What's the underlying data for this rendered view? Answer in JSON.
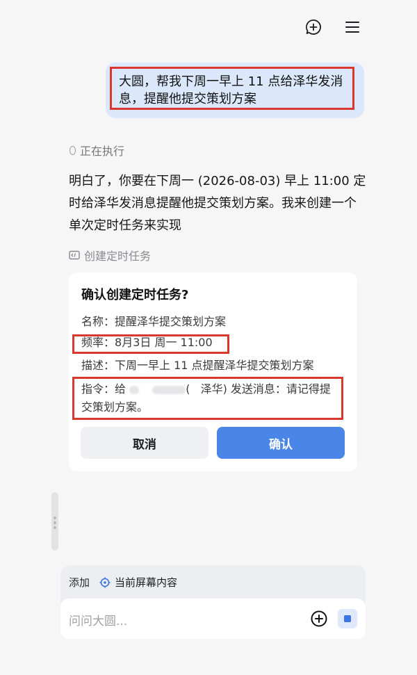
{
  "header": {
    "new_chat_icon": "chat-plus-icon",
    "menu_icon": "hamburger-menu-icon"
  },
  "user_message": {
    "text": "大圆，帮我下周一早上 11 点给泽华发消息，提醒他提交策划方案"
  },
  "status": {
    "text": "正在执行"
  },
  "assistant_reply": {
    "text": "明白了，你要在下周一 (2026-08-03) 早上 11:00 定时给泽华发消息提醒他提交策划方案。我来创建一个单次定时任务来实现"
  },
  "tool_call": {
    "label": "创建定时任务",
    "icon": "code-window-icon"
  },
  "confirm_card": {
    "title": "确认创建定时任务?",
    "name_label": "名称：",
    "name_value": "提醒泽华提交策划方案",
    "freq_label": "频率：",
    "freq_value": "8月3日 周一 11:00",
    "desc_label": "描述：",
    "desc_value": "下周一早上 11 点提醒泽华提交策划方案",
    "cmd_label": "指令：",
    "cmd_prefix": "给",
    "cmd_paren_open": "(",
    "cmd_name": "泽华)",
    "cmd_suffix": "发送消息：请记得提交策划方案。",
    "cancel_label": "取消",
    "confirm_label": "确认"
  },
  "composer": {
    "add_label": "添加",
    "context_chip_label": "当前屏幕内容",
    "placeholder": "问问大圆...",
    "accent_color": "#3b74e3"
  },
  "colors": {
    "highlight_border": "#d9382f",
    "user_bubble": "#dbe8fb",
    "confirm_button": "#4a86e8"
  }
}
